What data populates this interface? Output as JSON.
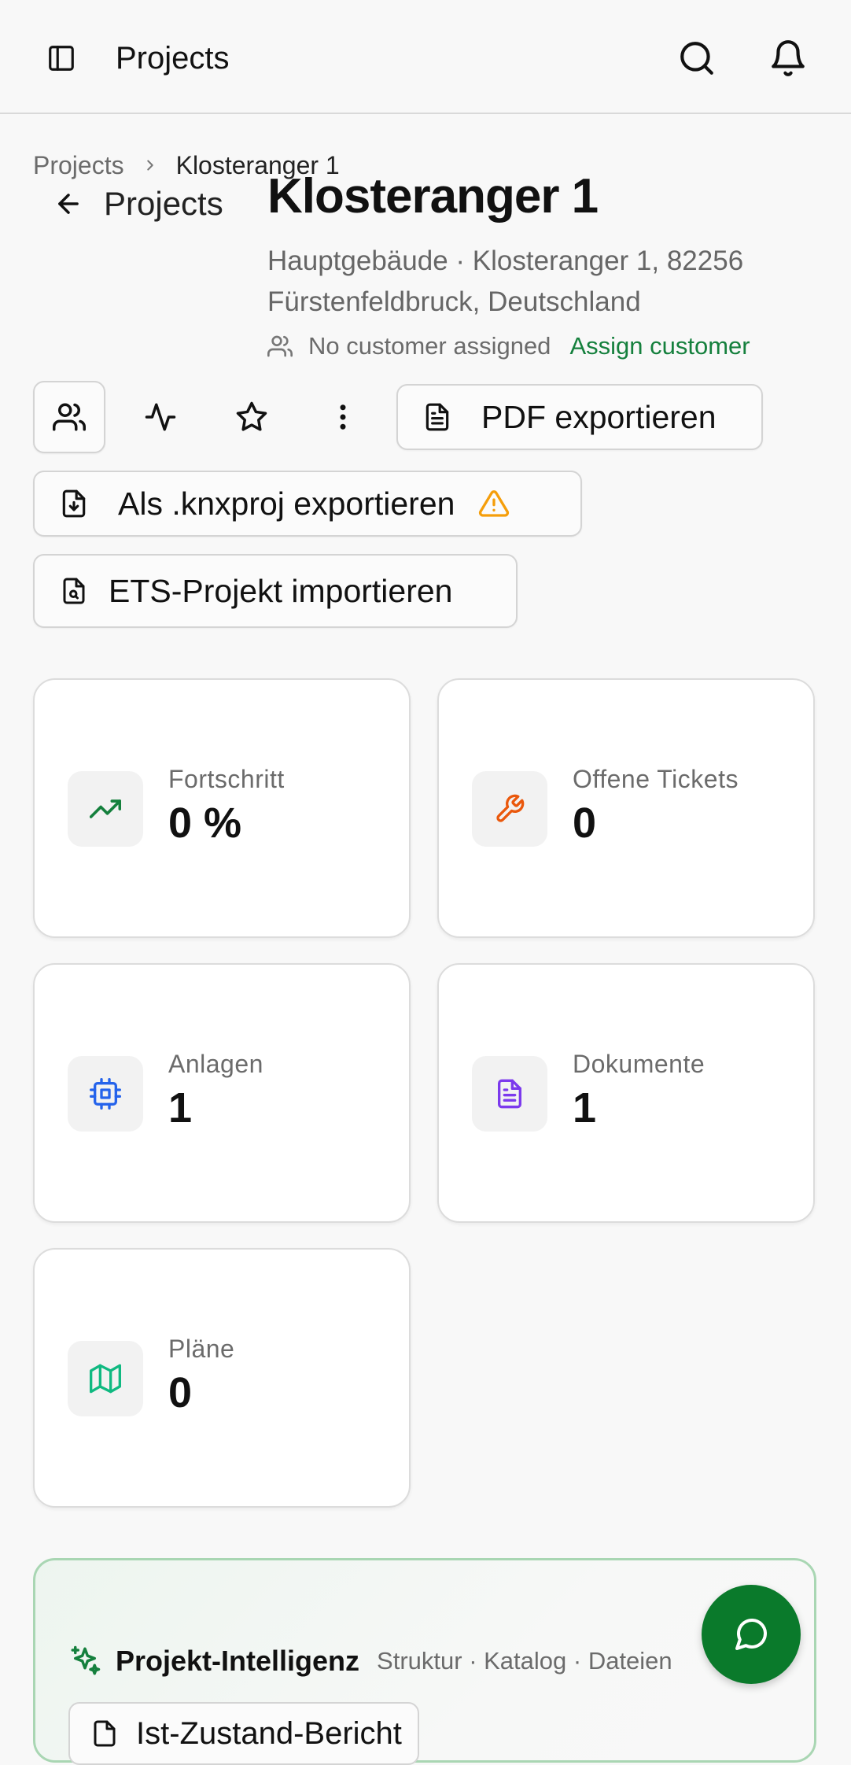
{
  "header": {
    "title": "Projects",
    "icons": {
      "sidebar": "panel-left-icon",
      "search": "search-icon",
      "notifications": "bell-icon"
    }
  },
  "breadcrumb": {
    "root": "Projects",
    "current": "Klosteranger 1"
  },
  "back_link": {
    "label": "Projects"
  },
  "project": {
    "title": "Klosteranger 1",
    "address": "Hauptgebäude · Klosteranger 1, 82256 Fürstenfeldbruck, Deutschland",
    "customer_text": "No customer assigned",
    "assign_label": "Assign customer"
  },
  "toolbar": {
    "pdf_label": "PDF exportieren",
    "knxproj_label": "Als .knxproj exportieren",
    "ets_label": "ETS-Projekt importieren"
  },
  "stats": [
    {
      "label": "Fortschritt",
      "value": "0 %",
      "icon": "trending-up-icon",
      "color": "#15803d"
    },
    {
      "label": "Offene Tickets",
      "value": "0",
      "icon": "wrench-icon",
      "color": "#ea580c"
    },
    {
      "label": "Anlagen",
      "value": "1",
      "icon": "cpu-icon",
      "color": "#2563eb"
    },
    {
      "label": "Dokumente",
      "value": "1",
      "icon": "file-text-icon",
      "color": "#7c3aed"
    },
    {
      "label": "Pläne",
      "value": "0",
      "icon": "map-icon",
      "color": "#10b981"
    }
  ],
  "intelligence": {
    "title": "Projekt-Intelligenz",
    "meta": "Struktur · Katalog · Dateien",
    "report_label": "Ist-Zustand-Bericht"
  },
  "colors": {
    "accent": "#15803d",
    "fab": "#0a7a2b",
    "warning": "#f59e0b"
  }
}
